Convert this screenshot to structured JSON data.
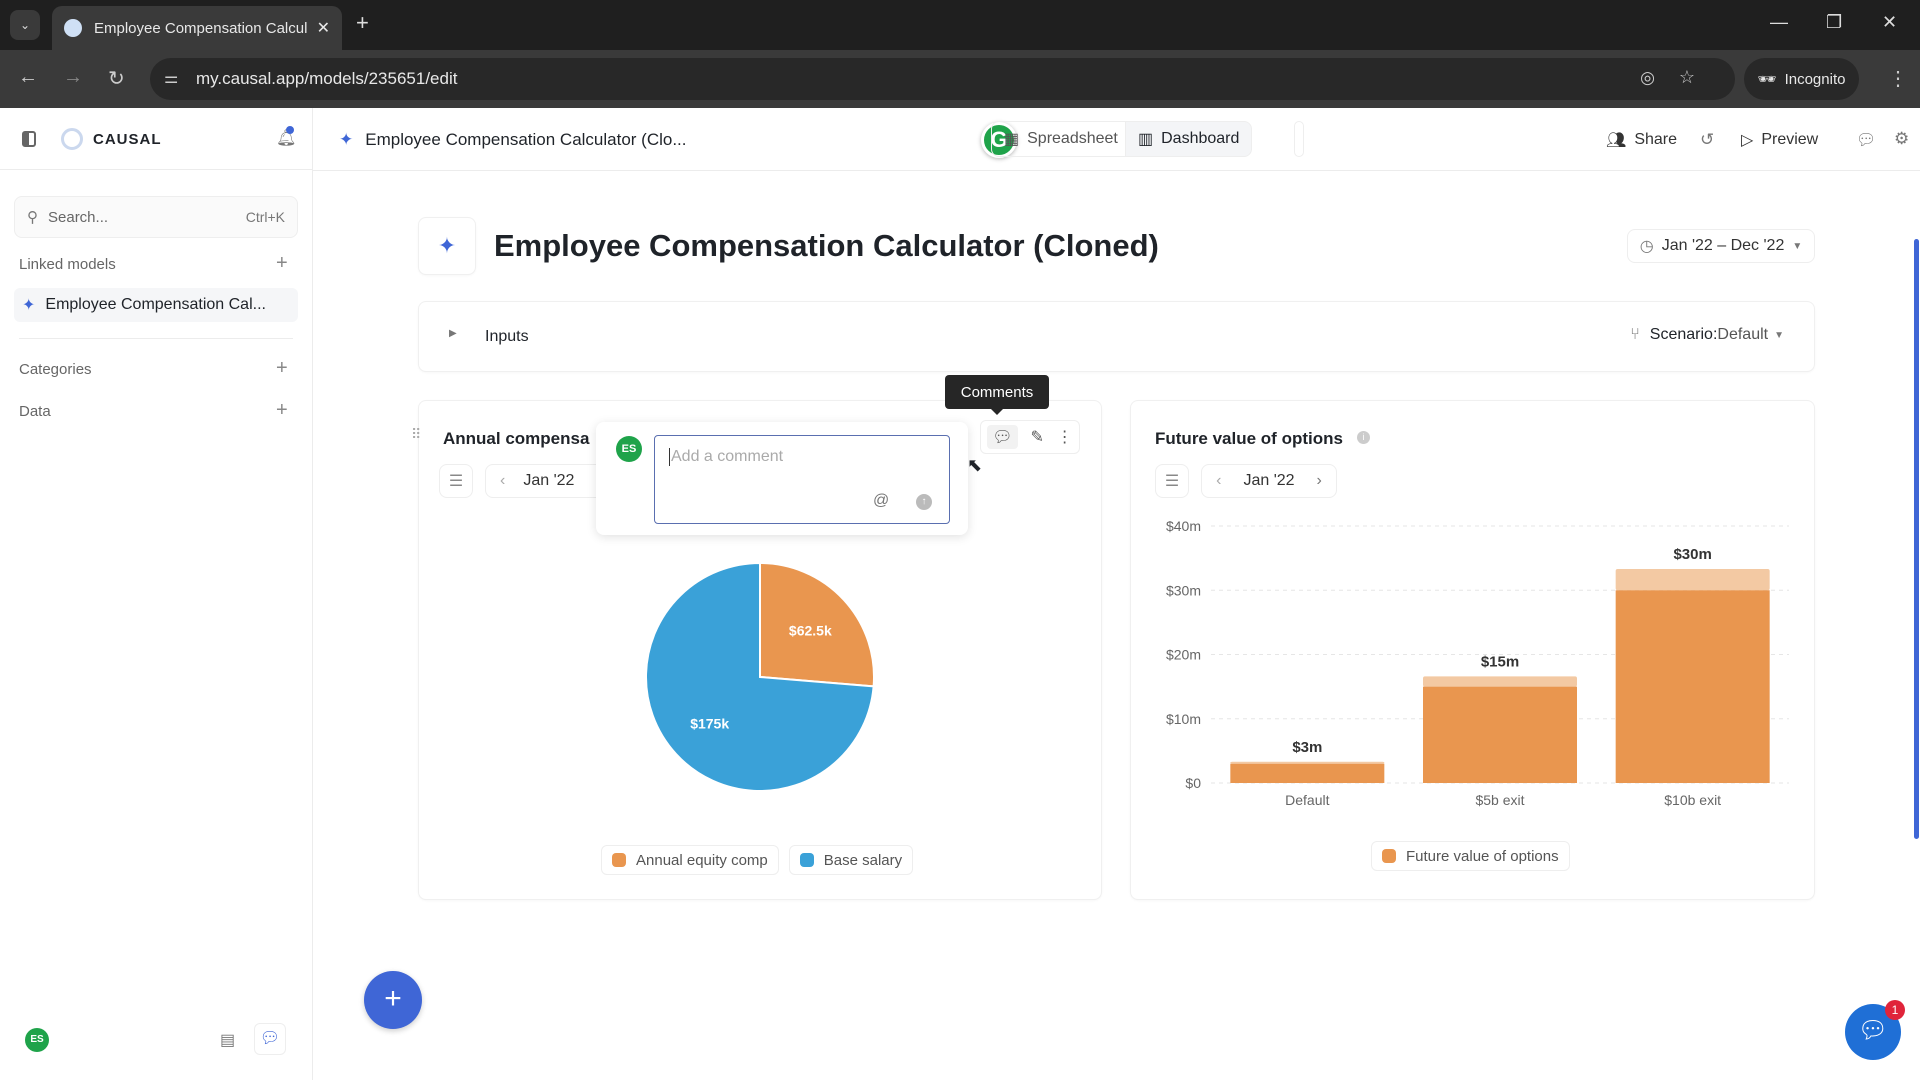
{
  "browser": {
    "tab_title": "Employee Compensation Calcul",
    "url": "my.causal.app/models/235651/edit",
    "incognito_label": "Incognito"
  },
  "sidebar": {
    "brand": "CAUSAL",
    "search_placeholder": "Search...",
    "search_shortcut": "Ctrl+K",
    "linked_models_label": "Linked models",
    "linked_model_item": "Employee Compensation Cal...",
    "categories_label": "Categories",
    "data_label": "Data",
    "user_initials": "ES"
  },
  "header": {
    "model_name": "Employee Compensation Calculator (Clo...",
    "spreadsheet_label": "Spreadsheet",
    "dashboard_label": "Dashboard",
    "share_label": "Share",
    "preview_label": "Preview"
  },
  "page": {
    "title": "Employee Compensation Calculator (Cloned)",
    "date_range": "Jan '22 – Dec '22",
    "inputs_label": "Inputs",
    "scenario_label": "Scenario:",
    "scenario_value": "Default"
  },
  "comment": {
    "user_initials": "ES",
    "placeholder": "Add a comment",
    "tooltip": "Comments"
  },
  "colors": {
    "orange": "#E9964F",
    "blue": "#3AA1D8",
    "accent": "#3F66D6",
    "green": "#1FA34A"
  },
  "chat_badge": "1",
  "chart_data": [
    {
      "type": "pie",
      "title": "Annual compensa",
      "period": "Jan '22",
      "slices": [
        {
          "name": "Annual equity comp",
          "value": 62.5,
          "label": "$62.5k",
          "color": "#E9964F"
        },
        {
          "name": "Base salary",
          "value": 175,
          "label": "$175k",
          "color": "#3AA1D8"
        }
      ]
    },
    {
      "type": "bar",
      "title": "Future value of options",
      "period": "Jan '22",
      "categories": [
        "Default",
        "$5b exit",
        "$10b exit"
      ],
      "series": [
        {
          "name": "Future value of options",
          "values": [
            3,
            15,
            30
          ],
          "labels": [
            "$3m",
            "$15m",
            "$30m"
          ],
          "highlight_top": [
            3.3,
            16.6,
            33.3
          ],
          "color": "#E9964F"
        }
      ],
      "yticks": [
        "$0",
        "$10m",
        "$20m",
        "$30m",
        "$40m"
      ],
      "ylim": [
        0,
        40
      ],
      "grid": true,
      "legend": "bottom"
    }
  ]
}
